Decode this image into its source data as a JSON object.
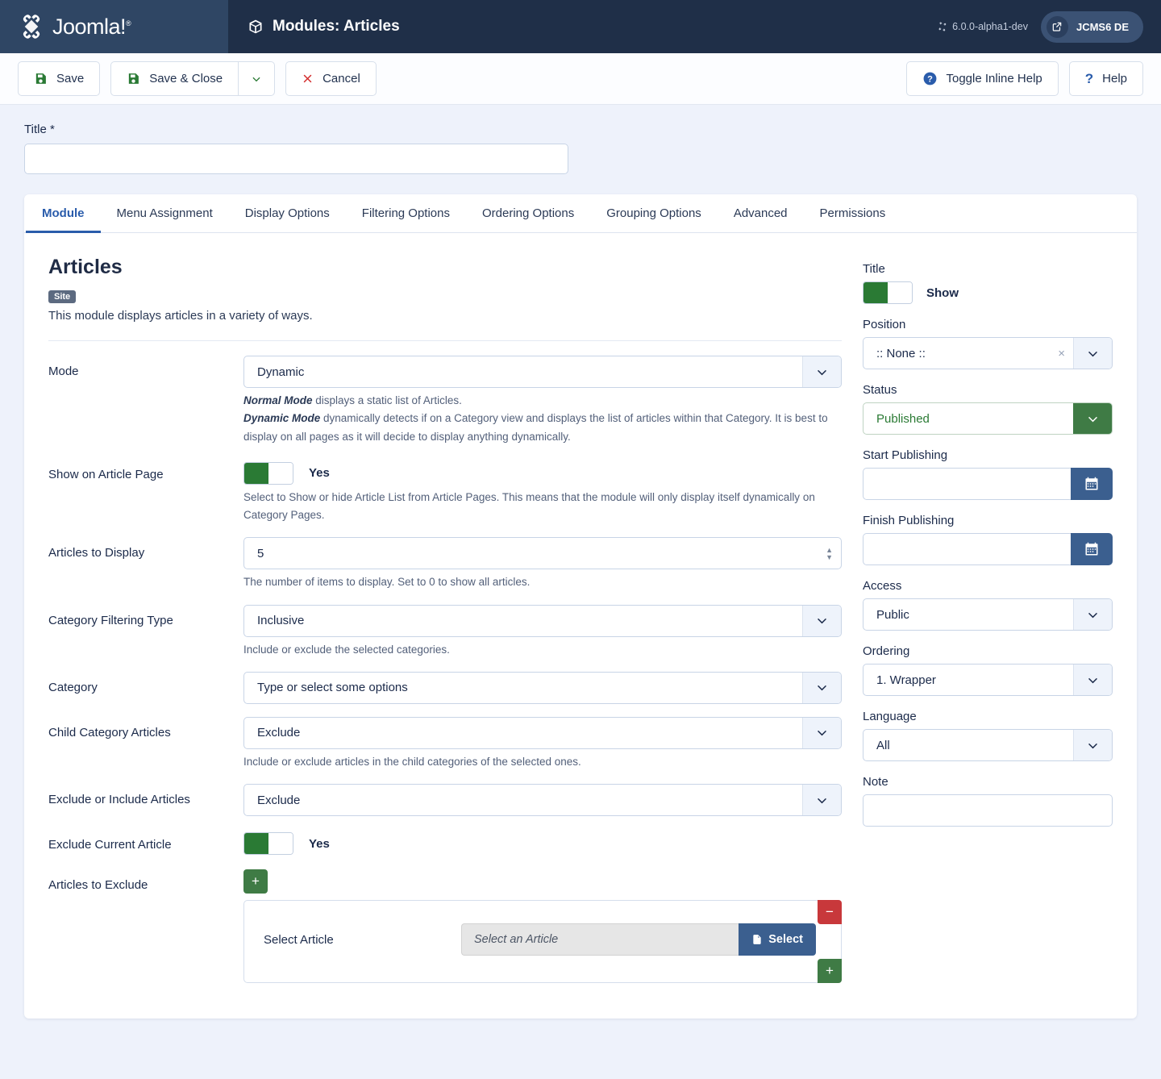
{
  "header": {
    "brand": "Joomla!",
    "title": "Modules: Articles",
    "title_icon": "cube-icon",
    "version": "6.0.0-alpha1-dev",
    "site_button": "JCMS6 DE",
    "site_button_icon": "external-link-icon"
  },
  "toolbar": {
    "save": "Save",
    "save_close": "Save & Close",
    "cancel": "Cancel",
    "toggle_inline_help": "Toggle Inline Help",
    "help": "Help"
  },
  "title_field": {
    "label": "Title *",
    "value": "",
    "placeholder": ""
  },
  "tabs": [
    {
      "label": "Module",
      "active": true
    },
    {
      "label": "Menu Assignment",
      "active": false
    },
    {
      "label": "Display Options",
      "active": false
    },
    {
      "label": "Filtering Options",
      "active": false
    },
    {
      "label": "Ordering Options",
      "active": false
    },
    {
      "label": "Grouping Options",
      "active": false
    },
    {
      "label": "Advanced",
      "active": false
    },
    {
      "label": "Permissions",
      "active": false
    }
  ],
  "module": {
    "name": "Articles",
    "badge": "Site",
    "description": "This module displays articles in a variety of ways.",
    "fields": {
      "mode": {
        "label": "Mode",
        "value": "Dynamic",
        "help_1_strong": "Normal Mode",
        "help_1_rest": " displays a static list of Articles.",
        "help_2_strong": "Dynamic Mode",
        "help_2_rest": " dynamically detects if on a Category view and displays the list of articles within that Category. It is best to display on all pages as it will decide to display anything dynamically."
      },
      "show_on_article_page": {
        "label": "Show on Article Page",
        "value": "Yes",
        "help": "Select to Show or hide Article List from Article Pages. This means that the module will only display itself dynamically on Category Pages."
      },
      "articles_to_display": {
        "label": "Articles to Display",
        "value": "5",
        "help": "The number of items to display. Set to 0 to show all articles."
      },
      "category_filtering_type": {
        "label": "Category Filtering Type",
        "value": "Inclusive",
        "help": "Include or exclude the selected categories."
      },
      "category": {
        "label": "Category",
        "value": "Type or select some options"
      },
      "child_category_articles": {
        "label": "Child Category Articles",
        "value": "Exclude",
        "help": "Include or exclude articles in the child categories of the selected ones."
      },
      "exclude_or_include_articles": {
        "label": "Exclude or Include Articles",
        "value": "Exclude"
      },
      "exclude_current_article": {
        "label": "Exclude Current Article",
        "value": "Yes"
      },
      "articles_to_exclude": {
        "label": "Articles to Exclude",
        "add_label": "+"
      },
      "select_article": {
        "label": "Select Article",
        "placeholder": "Select an Article",
        "button": "Select",
        "remove_label": "−",
        "add_label": "+"
      }
    }
  },
  "sidebar": {
    "title": {
      "label": "Title",
      "value": "Show"
    },
    "position": {
      "label": "Position",
      "value": ":: None ::",
      "clear": "×"
    },
    "status": {
      "label": "Status",
      "value": "Published"
    },
    "start_publishing": {
      "label": "Start Publishing",
      "value": ""
    },
    "finish_publishing": {
      "label": "Finish Publishing",
      "value": ""
    },
    "access": {
      "label": "Access",
      "value": "Public"
    },
    "ordering": {
      "label": "Ordering",
      "value": "1. Wrapper"
    },
    "language": {
      "label": "Language",
      "value": "All"
    },
    "note": {
      "label": "Note",
      "value": ""
    }
  },
  "colors": {
    "header_bg": "#1f2f48",
    "brand_bg": "#2f4664",
    "accent_blue": "#2a5cab",
    "green": "#2a7a34",
    "red": "#c8383b",
    "dark_blue_btn": "#3b5f8f",
    "page_bg": "#eef2fb"
  }
}
